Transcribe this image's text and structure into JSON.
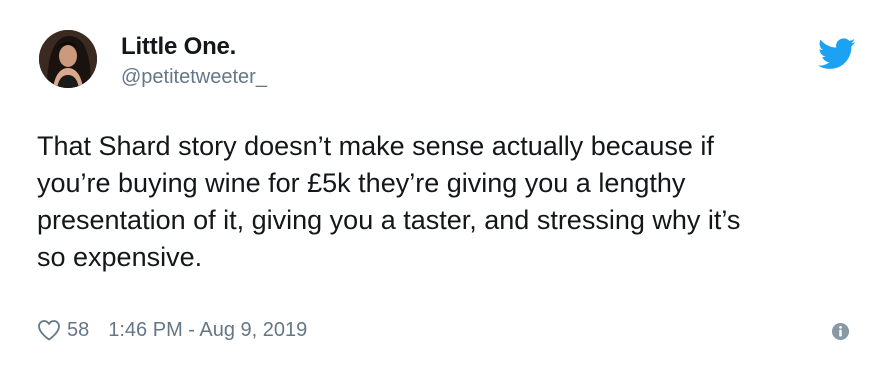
{
  "author": {
    "display_name": "Little One.",
    "handle": "@petitetweeter_"
  },
  "tweet": {
    "text": "That Shard story doesn’t make sense actually because if\nyou’re buying wine for £5k they’re giving you a lengthy\npresentation of it, giving you a taster, and stressing why it’s\nso expensive."
  },
  "footer": {
    "like_count": "58",
    "timestamp": "1:46 PM - Aug 9, 2019"
  },
  "icons": {
    "brand": "twitter-bird-icon",
    "like": "heart-icon",
    "info": "info-icon"
  },
  "colors": {
    "twitter_blue": "#1da1f2",
    "secondary_text": "#657786",
    "primary_text": "#14171a"
  }
}
